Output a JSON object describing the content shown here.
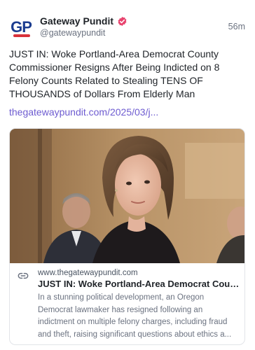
{
  "post": {
    "author_name": "Gateway Pundit",
    "author_handle": "@gatewaypundit",
    "time_ago": "56m",
    "avatar_text": "GP",
    "text": "JUST IN: Woke Portland-Area Democrat County Commissioner Resigns After Being Indicted on 8 Felony Counts Related to Stealing TENS OF THOUSANDS of Dollars From Elderly Man",
    "link_text": "thegatewaypundit.com/2025/03/j..."
  },
  "card": {
    "domain": "www.thegatewaypundit.com",
    "title": "JUST IN: Woke Portland-Area Democrat Count...",
    "description": "In a stunning political development, an Oregon Democrat lawmaker has resigned following an indictment on multiple felony charges, including fraud and theft, raising significant questions about ethics a..."
  },
  "icons": {
    "verified": "verified-badge-icon",
    "link": "link-icon"
  },
  "colors": {
    "link": "#6d5bd0",
    "verified_badge": "#e8436e",
    "brand_blue": "#1b3c8f",
    "brand_red": "#d8313a"
  }
}
